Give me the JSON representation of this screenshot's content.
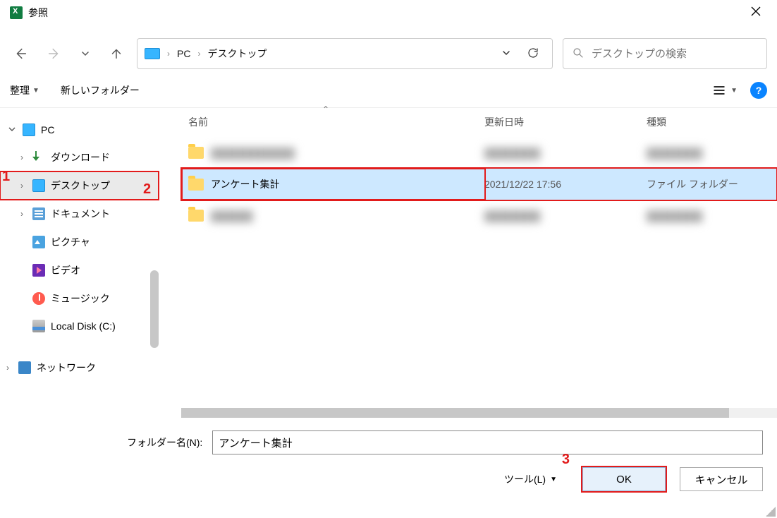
{
  "window": {
    "title": "参照"
  },
  "breadcrumb": {
    "root": "PC",
    "current": "デスクトップ"
  },
  "search": {
    "placeholder": "デスクトップの検索"
  },
  "commands": {
    "organize": "整理",
    "newFolder": "新しいフォルダー"
  },
  "columns": {
    "name": "名前",
    "date": "更新日時",
    "type": "種類"
  },
  "sidebar": {
    "root": "PC",
    "items": [
      {
        "label": "ダウンロード"
      },
      {
        "label": "デスクトップ"
      },
      {
        "label": "ドキュメント"
      },
      {
        "label": "ピクチャ"
      },
      {
        "label": "ビデオ"
      },
      {
        "label": "ミュージック"
      },
      {
        "label": "Local Disk (C:)"
      }
    ],
    "network": "ネットワーク"
  },
  "files": {
    "blur1": {
      "name": "████████████",
      "date": "████████",
      "type": "████████"
    },
    "selected": {
      "name": "アンケート集計",
      "date": "2021/12/22 17:56",
      "type": "ファイル フォルダー"
    },
    "blur2": {
      "name": "██████",
      "date": "████████",
      "type": "████████"
    }
  },
  "footer": {
    "folderNameLabel": "フォルダー名(N):",
    "folderNameValue": "アンケート集計",
    "tools": "ツール(L)",
    "ok": "OK",
    "cancel": "キャンセル"
  },
  "annotations": {
    "a1": "1",
    "a2": "2",
    "a3": "3"
  }
}
